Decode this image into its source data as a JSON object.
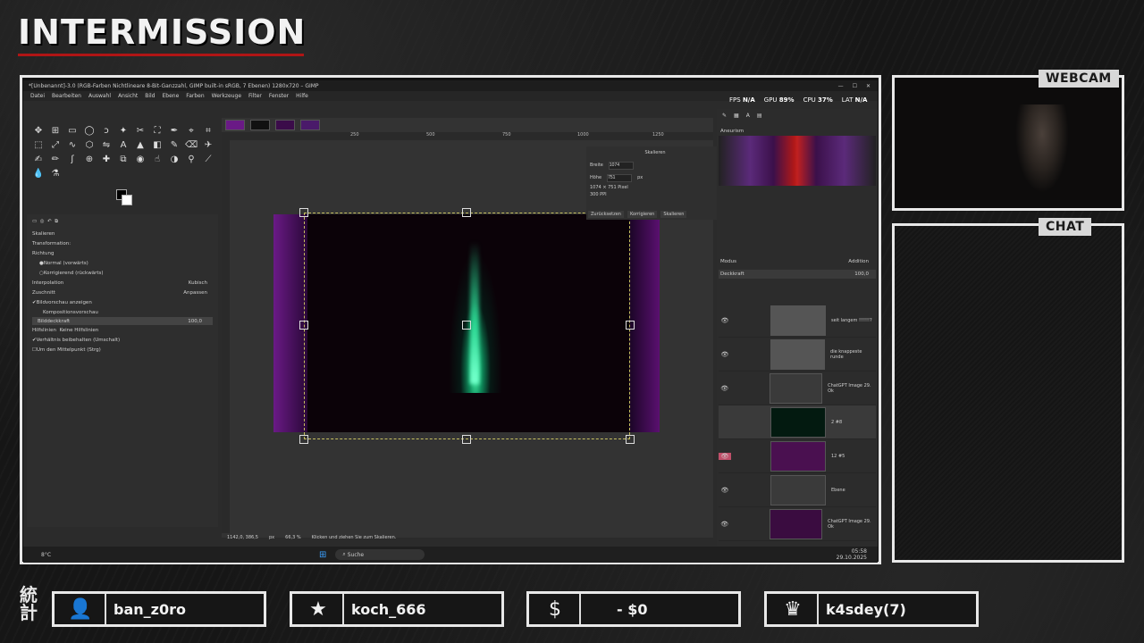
{
  "overlay": {
    "title": "INTERMISSION",
    "webcam_label": "WEBCAM",
    "chat_label": "CHAT",
    "kanji": "統計",
    "stats": [
      {
        "icon": "add-user-icon",
        "text": "ban_z0ro"
      },
      {
        "icon": "star-icon",
        "text": "koch_666"
      },
      {
        "icon": "dollar-icon",
        "text": "- $0"
      },
      {
        "icon": "crown-icon",
        "text": "k4sdey",
        "suffix": "(7)"
      }
    ]
  },
  "gimp": {
    "titlebar": "*[Unbenannt]-3.0 (RGB-Farben Nichtlineare 8-Bit-Ganzzahl, GIMP built-in sRGB, 7 Ebenen) 1280x720 – GIMP",
    "menu": [
      "Datei",
      "Bearbeiten",
      "Auswahl",
      "Ansicht",
      "Bild",
      "Ebene",
      "Farben",
      "Werkzeuge",
      "Filter",
      "Fenster",
      "Hilfe"
    ],
    "perf": {
      "fps_label": "FPS",
      "fps": "N/A",
      "gpu_label": "GPU",
      "gpu": "89%",
      "cpu_label": "CPU",
      "cpu": "37%",
      "lat_label": "LAT",
      "lat": "N/A"
    },
    "tool_options": {
      "header": "Skalieren",
      "transformation": "Transformation:",
      "direction": "Richtung",
      "normal": "Normal (vorwärts)",
      "corrective": "Korrigierend (rückwärts)",
      "interpolation_label": "Interpolation",
      "interpolation_value": "Kubisch",
      "clipping_label": "Zuschnitt",
      "clipping_value": "Anpassen",
      "preview": "Bildvorschau anzeigen",
      "composite": "Kompositionsvorschau",
      "opacity_label": "Bilddeckkraft",
      "opacity_value": "100,0",
      "guides_label": "Hilfslinien",
      "guides_value": "Keine Hilfslinien",
      "keep_aspect": "Verhältnis beibehalten (Umschalt)",
      "around_center": "Um den Mittelpunkt (Strg)"
    },
    "ruler": [
      "250",
      "500",
      "750",
      "1000",
      "1250"
    ],
    "scale_dialog": {
      "title": "Skalieren",
      "width_label": "Breite",
      "width": "1074",
      "height_label": "Höhe",
      "height": "751",
      "unit": "px",
      "info1": "1074 × 751 Pixel",
      "info2": "300 PPI",
      "reset": "Zurücksetzen",
      "correct": "Korrigieren",
      "scale": "Skalieren"
    },
    "statusbar": {
      "coords": "1142,0, 386,5",
      "unit": "px",
      "zoom": "66,3 %",
      "hint": "Klicken und ziehen Sie zum Skalieren."
    },
    "dock": {
      "gradient_name": "Aneurism",
      "mode_label": "Modus",
      "mode_value": "Addition",
      "opacity_label": "Deckkraft",
      "opacity_value": "100,0",
      "layers": [
        {
          "name": "seit langem !!!!!!?"
        },
        {
          "name": "die knappeste runde"
        },
        {
          "name": "ChatGPT Image 29. Ok"
        },
        {
          "name": "2 #8"
        },
        {
          "name": "12 #5"
        },
        {
          "name": "Ebene"
        },
        {
          "name": "ChatGPT Image 29. Ok"
        }
      ]
    },
    "taskbar": {
      "weather": "8°C",
      "search": "Suche",
      "time": "05:58",
      "date": "29.10.2025"
    }
  }
}
